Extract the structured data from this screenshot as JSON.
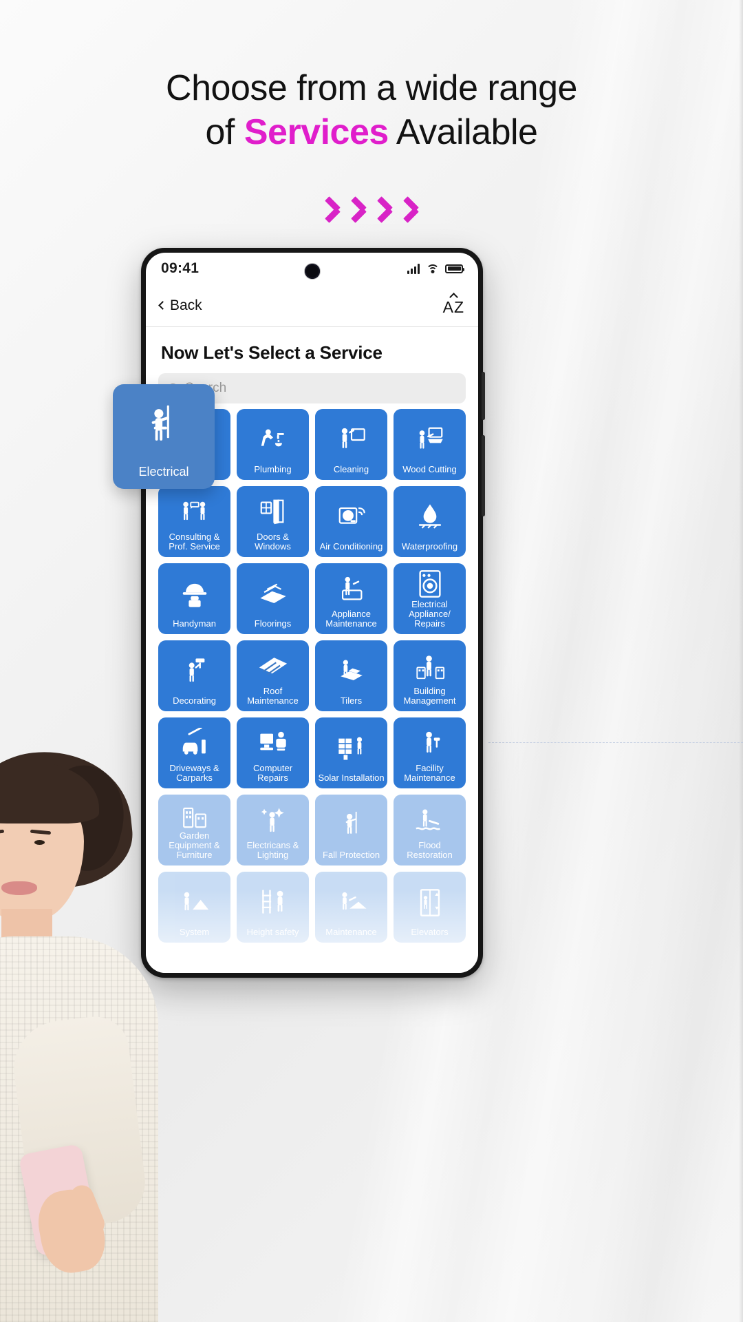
{
  "headline": {
    "line1": "Choose from a wide range",
    "line2_pre": "of ",
    "line2_accent": "Services",
    "line2_post": " Available",
    "accent_color": "#e01ecb"
  },
  "chevrons": {
    "count": 4,
    "glyph": "chevron-right",
    "color": "#d823c6"
  },
  "phone": {
    "statusbar": {
      "time": "09:41",
      "signal_icon": "cellular-signal-icon",
      "wifi_icon": "wifi-icon",
      "battery_icon": "battery-full-icon",
      "camera": "front-camera-punch-hole"
    },
    "navbar": {
      "back_label": "Back",
      "back_icon": "chevron-left-icon",
      "sort_label": "AZ",
      "sort_icon": "sort-alphabetical-icon"
    },
    "page_title": "Now Let's Select a Service",
    "search": {
      "placeholder": "Search",
      "value": "",
      "icon": "search-icon"
    },
    "featured_tile": {
      "label": "Electrical",
      "icon": "electrician-harness-icon"
    },
    "tiles": [
      {
        "label": "Electrical",
        "icon": "electrician-harness-icon",
        "fade": ""
      },
      {
        "label": "Plumbing",
        "icon": "plumber-tap-icon",
        "fade": ""
      },
      {
        "label": "Cleaning",
        "icon": "window-cleaning-icon",
        "fade": ""
      },
      {
        "label": "Wood Cutting",
        "icon": "wood-cutting-icon",
        "fade": ""
      },
      {
        "label": "Consulting & Prof. Service",
        "icon": "consulting-people-icon",
        "fade": ""
      },
      {
        "label": "Doors & Windows",
        "icon": "door-window-icon",
        "fade": ""
      },
      {
        "label": "Air Conditioning",
        "icon": "air-conditioner-icon",
        "fade": ""
      },
      {
        "label": "Waterproofing",
        "icon": "waterproofing-drop-icon",
        "fade": ""
      },
      {
        "label": "Handyman",
        "icon": "handyman-helmet-icon",
        "fade": ""
      },
      {
        "label": "Floorings",
        "icon": "flooring-tiles-icon",
        "fade": ""
      },
      {
        "label": "Appliance Maintenance",
        "icon": "appliance-maintenance-icon",
        "fade": ""
      },
      {
        "label": "Electrical Appliance/ Repairs",
        "icon": "washing-machine-icon",
        "fade": ""
      },
      {
        "label": "Decorating",
        "icon": "painter-roller-icon",
        "fade": ""
      },
      {
        "label": "Roof Maintenance",
        "icon": "roof-maintenance-icon",
        "fade": ""
      },
      {
        "label": "Tilers",
        "icon": "tiler-icon",
        "fade": ""
      },
      {
        "label": "Building Management",
        "icon": "building-management-icon",
        "fade": ""
      },
      {
        "label": "Driveways & Carparks",
        "icon": "carpark-barrier-icon",
        "fade": ""
      },
      {
        "label": "Computer Repairs",
        "icon": "computer-repairs-icon",
        "fade": ""
      },
      {
        "label": "Solar Installation",
        "icon": "solar-panel-icon",
        "fade": ""
      },
      {
        "label": "Facility Maintenance",
        "icon": "facility-maintenance-icon",
        "fade": ""
      },
      {
        "label": "Garden Equipment & Furniture",
        "icon": "garden-equipment-icon",
        "fade": "fade-1"
      },
      {
        "label": "Electricans & Lighting",
        "icon": "lighting-icon",
        "fade": "fade-1"
      },
      {
        "label": "Fall Protection",
        "icon": "fall-protection-icon",
        "fade": "fade-1"
      },
      {
        "label": "Flood Restoration",
        "icon": "flood-restoration-icon",
        "fade": "fade-1"
      },
      {
        "label": "System",
        "icon": "system-icon",
        "fade": "fade-2"
      },
      {
        "label": "Height safety",
        "icon": "height-safety-ladder-icon",
        "fade": "fade-2"
      },
      {
        "label": "Maintenance",
        "icon": "maintenance-icon",
        "fade": "fade-2"
      },
      {
        "label": "Elevators",
        "icon": "elevator-icon",
        "fade": "fade-2"
      }
    ]
  }
}
